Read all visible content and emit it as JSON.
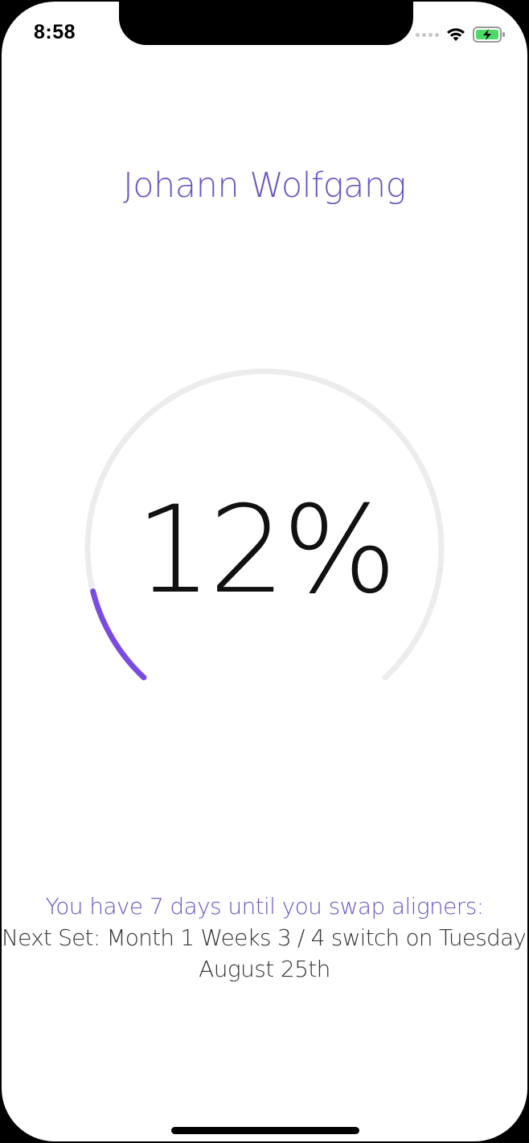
{
  "status_bar": {
    "time": "8:58",
    "icons": [
      "cellular-signal-icon",
      "wifi-icon",
      "battery-charging-icon"
    ]
  },
  "header": {
    "patient_name": "Johann Wolfgang"
  },
  "progress": {
    "percent_label": "12%",
    "fraction": 0.12,
    "track_color": "#ececec",
    "fill_color": "#7b4ce0"
  },
  "info": {
    "swap_message": "You have 7 days until you swap aligners:",
    "next_set_line": "Next Set:  Month 1 Weeks 3 / 4 switch on Tuesday,",
    "next_set_date": "August 25th"
  },
  "colors": {
    "accent": "#6b55c4",
    "text": "#333333"
  }
}
